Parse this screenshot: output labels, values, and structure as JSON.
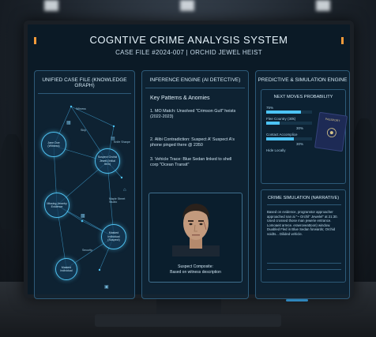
{
  "header": {
    "title": "COGNTIVE CRIME ANALYSIS SYSTEM",
    "subtitle": "CASE FILE #2024-007 | ORCHID JEWEL HEIST"
  },
  "knowledge_graph": {
    "title": "UNIFIED CASE FILE (KNOWLEDGE GRAPH)",
    "nodes": [
      {
        "label": "Jane Doe (Witness)"
      },
      {
        "label": "Suspect Orchid Jewel (Initial Item)"
      },
      {
        "label": "Missing Jewelry Evidence"
      },
      {
        "label": "Masked Individual (Suspect)"
      },
      {
        "label": "Masked Individual"
      }
    ],
    "small_labels": [
      "Witness",
      "Skip",
      "Knife Sharpe",
      "Maple Street Studio",
      "Security"
    ],
    "icons": [
      "folder-icon",
      "document-icon",
      "house-icon",
      "lock-icon",
      "chat-icon"
    ]
  },
  "inference": {
    "title": "INFERENCE ENGINE (AI DETECTIVE)",
    "heading": "Key Patterns & Anomies",
    "items": [
      "1. MO Match: Unsolved \"Crimson Gull\" heists (2022-2023)",
      "2. Alibi Contradiction: Suspect A' Suspect A's phone pinged there @ 2350",
      "3. Vehicle Trace: Blue Sedan linked to shell corp \"Ocean Transit\""
    ],
    "composite_caption_1": "Suspect Composite:",
    "composite_caption_2": "Based on witness description"
  },
  "prediction": {
    "title": "PREDICTIVE & SIMULATION ENGINE",
    "probability_title": "NEXT MOVES PROBABILITY",
    "bars": [
      {
        "label": "75%",
        "value": 75,
        "pct": ""
      },
      {
        "label": "Flee Country (30k)",
        "value": 30,
        "pct": "30%"
      },
      {
        "label": "Contact Accomplice",
        "value": 60,
        "pct": "30%"
      },
      {
        "label": "Hide Locally",
        "value": 10,
        "pct": ""
      }
    ],
    "passport_label": "PASSPORT",
    "simulation_title": "CRIME SIMULATION (NARRATIVE)",
    "simulation_text": "Based on evidence, progranstor approacher approached nan ai \"~ Orchil\" Jewelel\" at 21:30. Used crossed those man jewerie entrance. Lomoaeit arrece. eraeroveattoon) window. Duabled Fled in Blue Sedan forwards; Orchid voidts... Dilided vehicle."
  },
  "colors": {
    "accent": "#4cc4f5",
    "panel_border": "#2d5a78",
    "screen_bg": "#0b1a26",
    "highlight": "#f29a3a"
  }
}
